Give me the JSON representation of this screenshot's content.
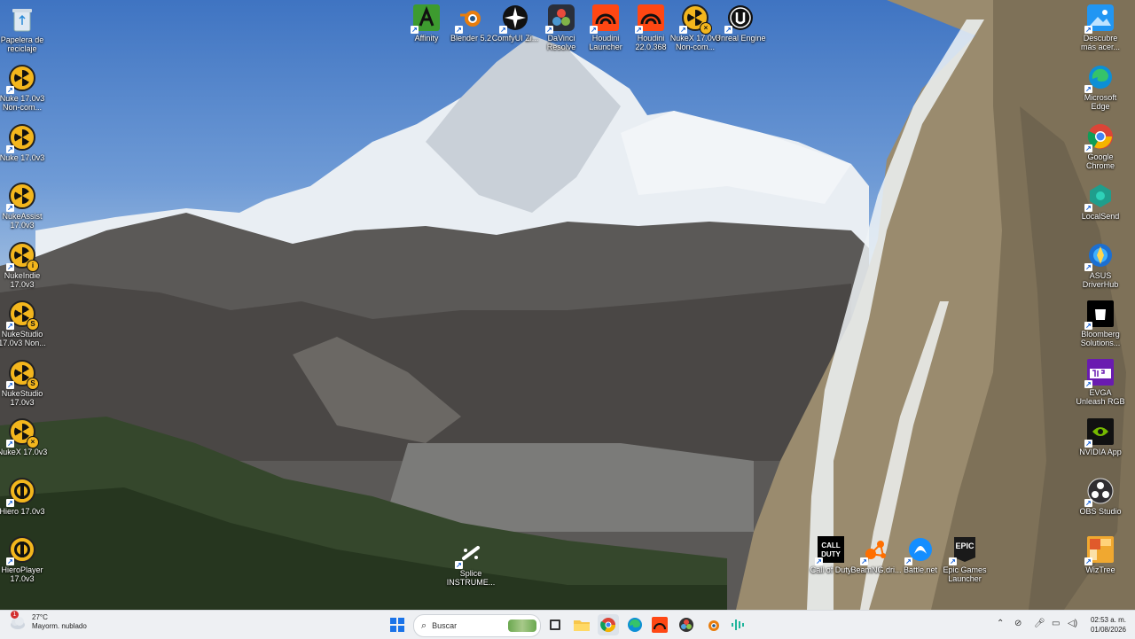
{
  "desktop": {
    "left_icons": [
      {
        "label": "Papelera de reciclaje",
        "icon": "recycle-bin-icon"
      },
      {
        "label": "Nuke 17.0v3 Non-com...",
        "icon": "nuke-icon"
      },
      {
        "label": "Nuke 17.0v3",
        "icon": "nuke-icon"
      },
      {
        "label": "NukeAssist 17.0v3",
        "icon": "nukeassist-icon"
      },
      {
        "label": "NukeIndie 17.0v3",
        "icon": "nukeindie-icon"
      },
      {
        "label": "NukeStudio 17.0v3 Non...",
        "icon": "nukestudio-icon"
      },
      {
        "label": "NukeStudio 17.0v3",
        "icon": "nukestudio-icon"
      },
      {
        "label": "NukeX 17.0v3",
        "icon": "nukex-icon"
      },
      {
        "label": "Hiero 17.0v3",
        "icon": "hiero-icon"
      },
      {
        "label": "HieroPlayer 17.0v3",
        "icon": "hieroplayer-icon"
      }
    ],
    "top_icons": [
      {
        "label": "Affinity",
        "icon": "affinity-icon",
        "color": "#3d9b2f"
      },
      {
        "label": "Blender 5.2",
        "icon": "blender-icon",
        "color": "#e87d0d"
      },
      {
        "label": "ComfyUI Zi...",
        "icon": "comfyui-icon",
        "color": "#111111"
      },
      {
        "label": "DaVinci Resolve",
        "icon": "davinci-resolve-icon",
        "color": "#2a2f3a"
      },
      {
        "label": "Houdini Launcher",
        "icon": "houdini-icon",
        "color": "#ff4713"
      },
      {
        "label": "Houdini 22.0.368",
        "icon": "houdini-icon",
        "color": "#ff4713"
      },
      {
        "label": "NukeX 17.0v3 Non-com...",
        "icon": "nukex-icon",
        "color": "#f3b61d"
      },
      {
        "label": "Unreal Engine",
        "icon": "unreal-engine-icon",
        "color": "#111111"
      }
    ],
    "right_icons": [
      {
        "label": "Descubre más acer...",
        "icon": "spotlight-icon",
        "color": "#1e88e5"
      },
      {
        "label": "Microsoft Edge",
        "icon": "edge-icon",
        "color": "#0c8fd6"
      },
      {
        "label": "Google Chrome",
        "icon": "chrome-icon",
        "color": "#db4437"
      },
      {
        "label": "LocalSend",
        "icon": "localsend-icon",
        "color": "#1f9e8c"
      },
      {
        "label": "ASUS DriverHub",
        "icon": "asus-driverhub-icon",
        "color": "#1c6fd1"
      },
      {
        "label": "Bloomberg Solutions...",
        "icon": "bloomberg-icon",
        "color": "#000000"
      },
      {
        "label": "EVGA Unleash RGB",
        "icon": "evga-rgb-icon",
        "color": "#6a1bb0"
      },
      {
        "label": "NVIDIA App",
        "icon": "nvidia-icon",
        "color": "#76b900"
      },
      {
        "label": "OBS Studio",
        "icon": "obs-icon",
        "color": "#302e31"
      },
      {
        "label": "WizTree",
        "icon": "wiztree-icon",
        "color": "#f0a830"
      }
    ],
    "bottom_icons": [
      {
        "label": "Call of Duty",
        "icon": "call-of-duty-icon",
        "color": "#000000"
      },
      {
        "label": "BeamNG.dri...",
        "icon": "beamng-icon",
        "color": "#ff6f00"
      },
      {
        "label": "Battle.net",
        "icon": "battlenet-icon",
        "color": "#148eff"
      },
      {
        "label": "Epic Games Launcher",
        "icon": "epic-games-icon",
        "color": "#1a1a1a"
      }
    ],
    "center_icon": {
      "label": "Splice INSTRUME...",
      "icon": "splice-icon"
    }
  },
  "taskbar": {
    "weather": {
      "temp": "27°C",
      "desc": "Mayorm. nublado",
      "alert": "1"
    },
    "search_placeholder": "Buscar",
    "clock": {
      "time": "02:53 a. m.",
      "date": "01/08/2026"
    },
    "apps": [
      {
        "name": "windows-start-icon",
        "color": "#1a73e8"
      },
      {
        "name": "task-view-icon",
        "color": "#333333"
      },
      {
        "name": "file-explorer-icon",
        "color": "#f7c64b"
      },
      {
        "name": "chrome-icon",
        "color": "#db4437"
      },
      {
        "name": "edge-icon",
        "color": "#0c8fd6"
      },
      {
        "name": "houdini-icon",
        "color": "#ff4713"
      },
      {
        "name": "davinci-resolve-icon",
        "color": "#333333"
      },
      {
        "name": "blender-icon",
        "color": "#e87d0d"
      },
      {
        "name": "audio-app-icon",
        "color": "#1fb59c"
      }
    ],
    "tray": [
      "chevron-up-icon",
      "network-off-icon",
      "microphone-icon",
      "display-icon",
      "speaker-icon"
    ]
  }
}
